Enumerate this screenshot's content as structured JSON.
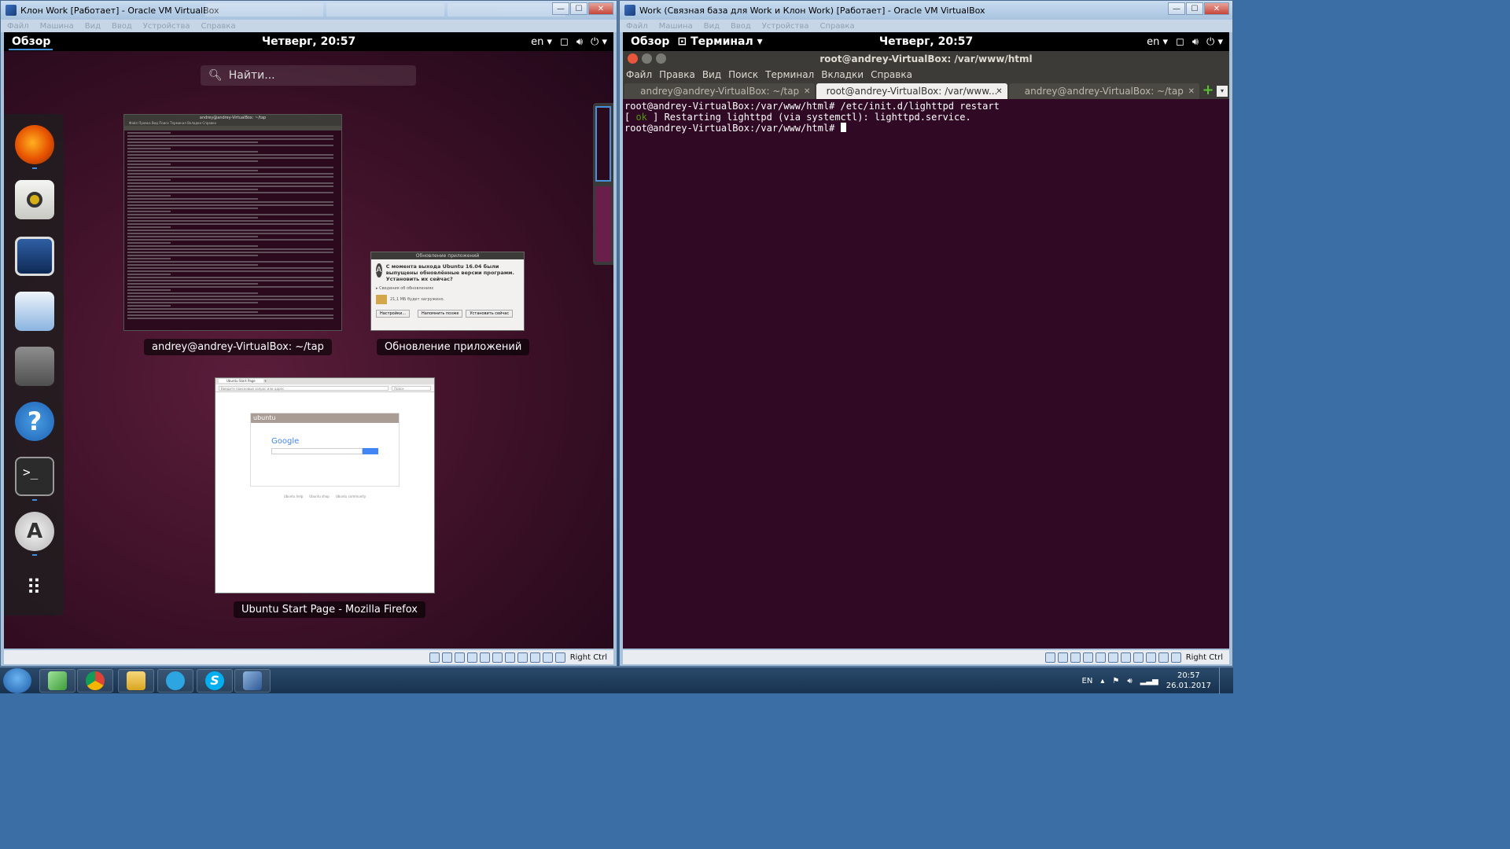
{
  "left_vbox": {
    "title": "Клон Work [Работает] - Oracle VM VirtualBox",
    "menu": [
      "Файл",
      "Машина",
      "Вид",
      "Ввод",
      "Устройства",
      "Справка"
    ],
    "host_key": "Right Ctrl"
  },
  "right_vbox": {
    "title": "Work (Связная база для Work и Клон Work) [Работает] - Oracle VM VirtualBox",
    "menu": [
      "Файл",
      "Машина",
      "Вид",
      "Ввод",
      "Устройства",
      "Справка"
    ],
    "host_key": "Right Ctrl"
  },
  "left_guest": {
    "activities": "Обзор",
    "clock": "Четверг, 20:57",
    "lang": "en",
    "search_placeholder": "Найти...",
    "windows": [
      {
        "label": "andrey@andrey-VirtualBox: ~/tap"
      },
      {
        "label": "Обновление приложений"
      },
      {
        "label": "Ubuntu Start Page - Mozilla Firefox"
      }
    ],
    "update_dialog": {
      "title": "Обновление приложений",
      "message": "С момента выхода Ubuntu 16.04 были выпущены обновлённые версии программ. Установить их сейчас?",
      "details": "Сведения об обновлениях",
      "size": "21,1 МБ будет загружено.",
      "btn_settings": "Настройки...",
      "btn_later": "Напомнить позже",
      "btn_install": "Установить сейчас"
    },
    "firefox_thumb": {
      "tab": "Ubuntu Start Page",
      "url_placeholder": "Введите поисковый запрос или адрес",
      "search_placeholder": "Поиск",
      "brand": "ubuntu",
      "google": "Google",
      "links": [
        "Ubuntu help",
        "Ubuntu shop",
        "Ubuntu community"
      ]
    },
    "term_thumb": {
      "title": "andrey@andrey-VirtualBox: ~/tap",
      "menu": "Файл Правка Вид Поиск Терминал Вкладки Справка"
    }
  },
  "right_guest": {
    "activities": "Обзор",
    "app_menu": "Терминал",
    "clock": "Четверг, 20:57",
    "lang": "en",
    "term_title": "root@andrey-VirtualBox: /var/www/html",
    "menu": [
      "Файл",
      "Правка",
      "Вид",
      "Поиск",
      "Терминал",
      "Вкладки",
      "Справка"
    ],
    "tabs": [
      {
        "label": "andrey@andrey-VirtualBox: ~/tap",
        "active": false
      },
      {
        "label": "root@andrey-VirtualBox: /var/www...",
        "active": true
      },
      {
        "label": "andrey@andrey-VirtualBox: ~/tap",
        "active": false
      }
    ],
    "lines": {
      "l1": "root@andrey-VirtualBox:/var/www/html# /etc/init.d/lighttpd restart",
      "l2_pre": "[ ",
      "l2_ok": "ok",
      "l2_post": " ] Restarting lighttpd (via systemctl): lighttpd.service.",
      "l3": "root@andrey-VirtualBox:/var/www/html# "
    }
  },
  "taskbar": {
    "lang": "EN",
    "time": "20:57",
    "date": "26.01.2017",
    "apps": [
      "notepad",
      "chrome",
      "explorer",
      "telegram",
      "skype",
      "virtualbox"
    ]
  }
}
